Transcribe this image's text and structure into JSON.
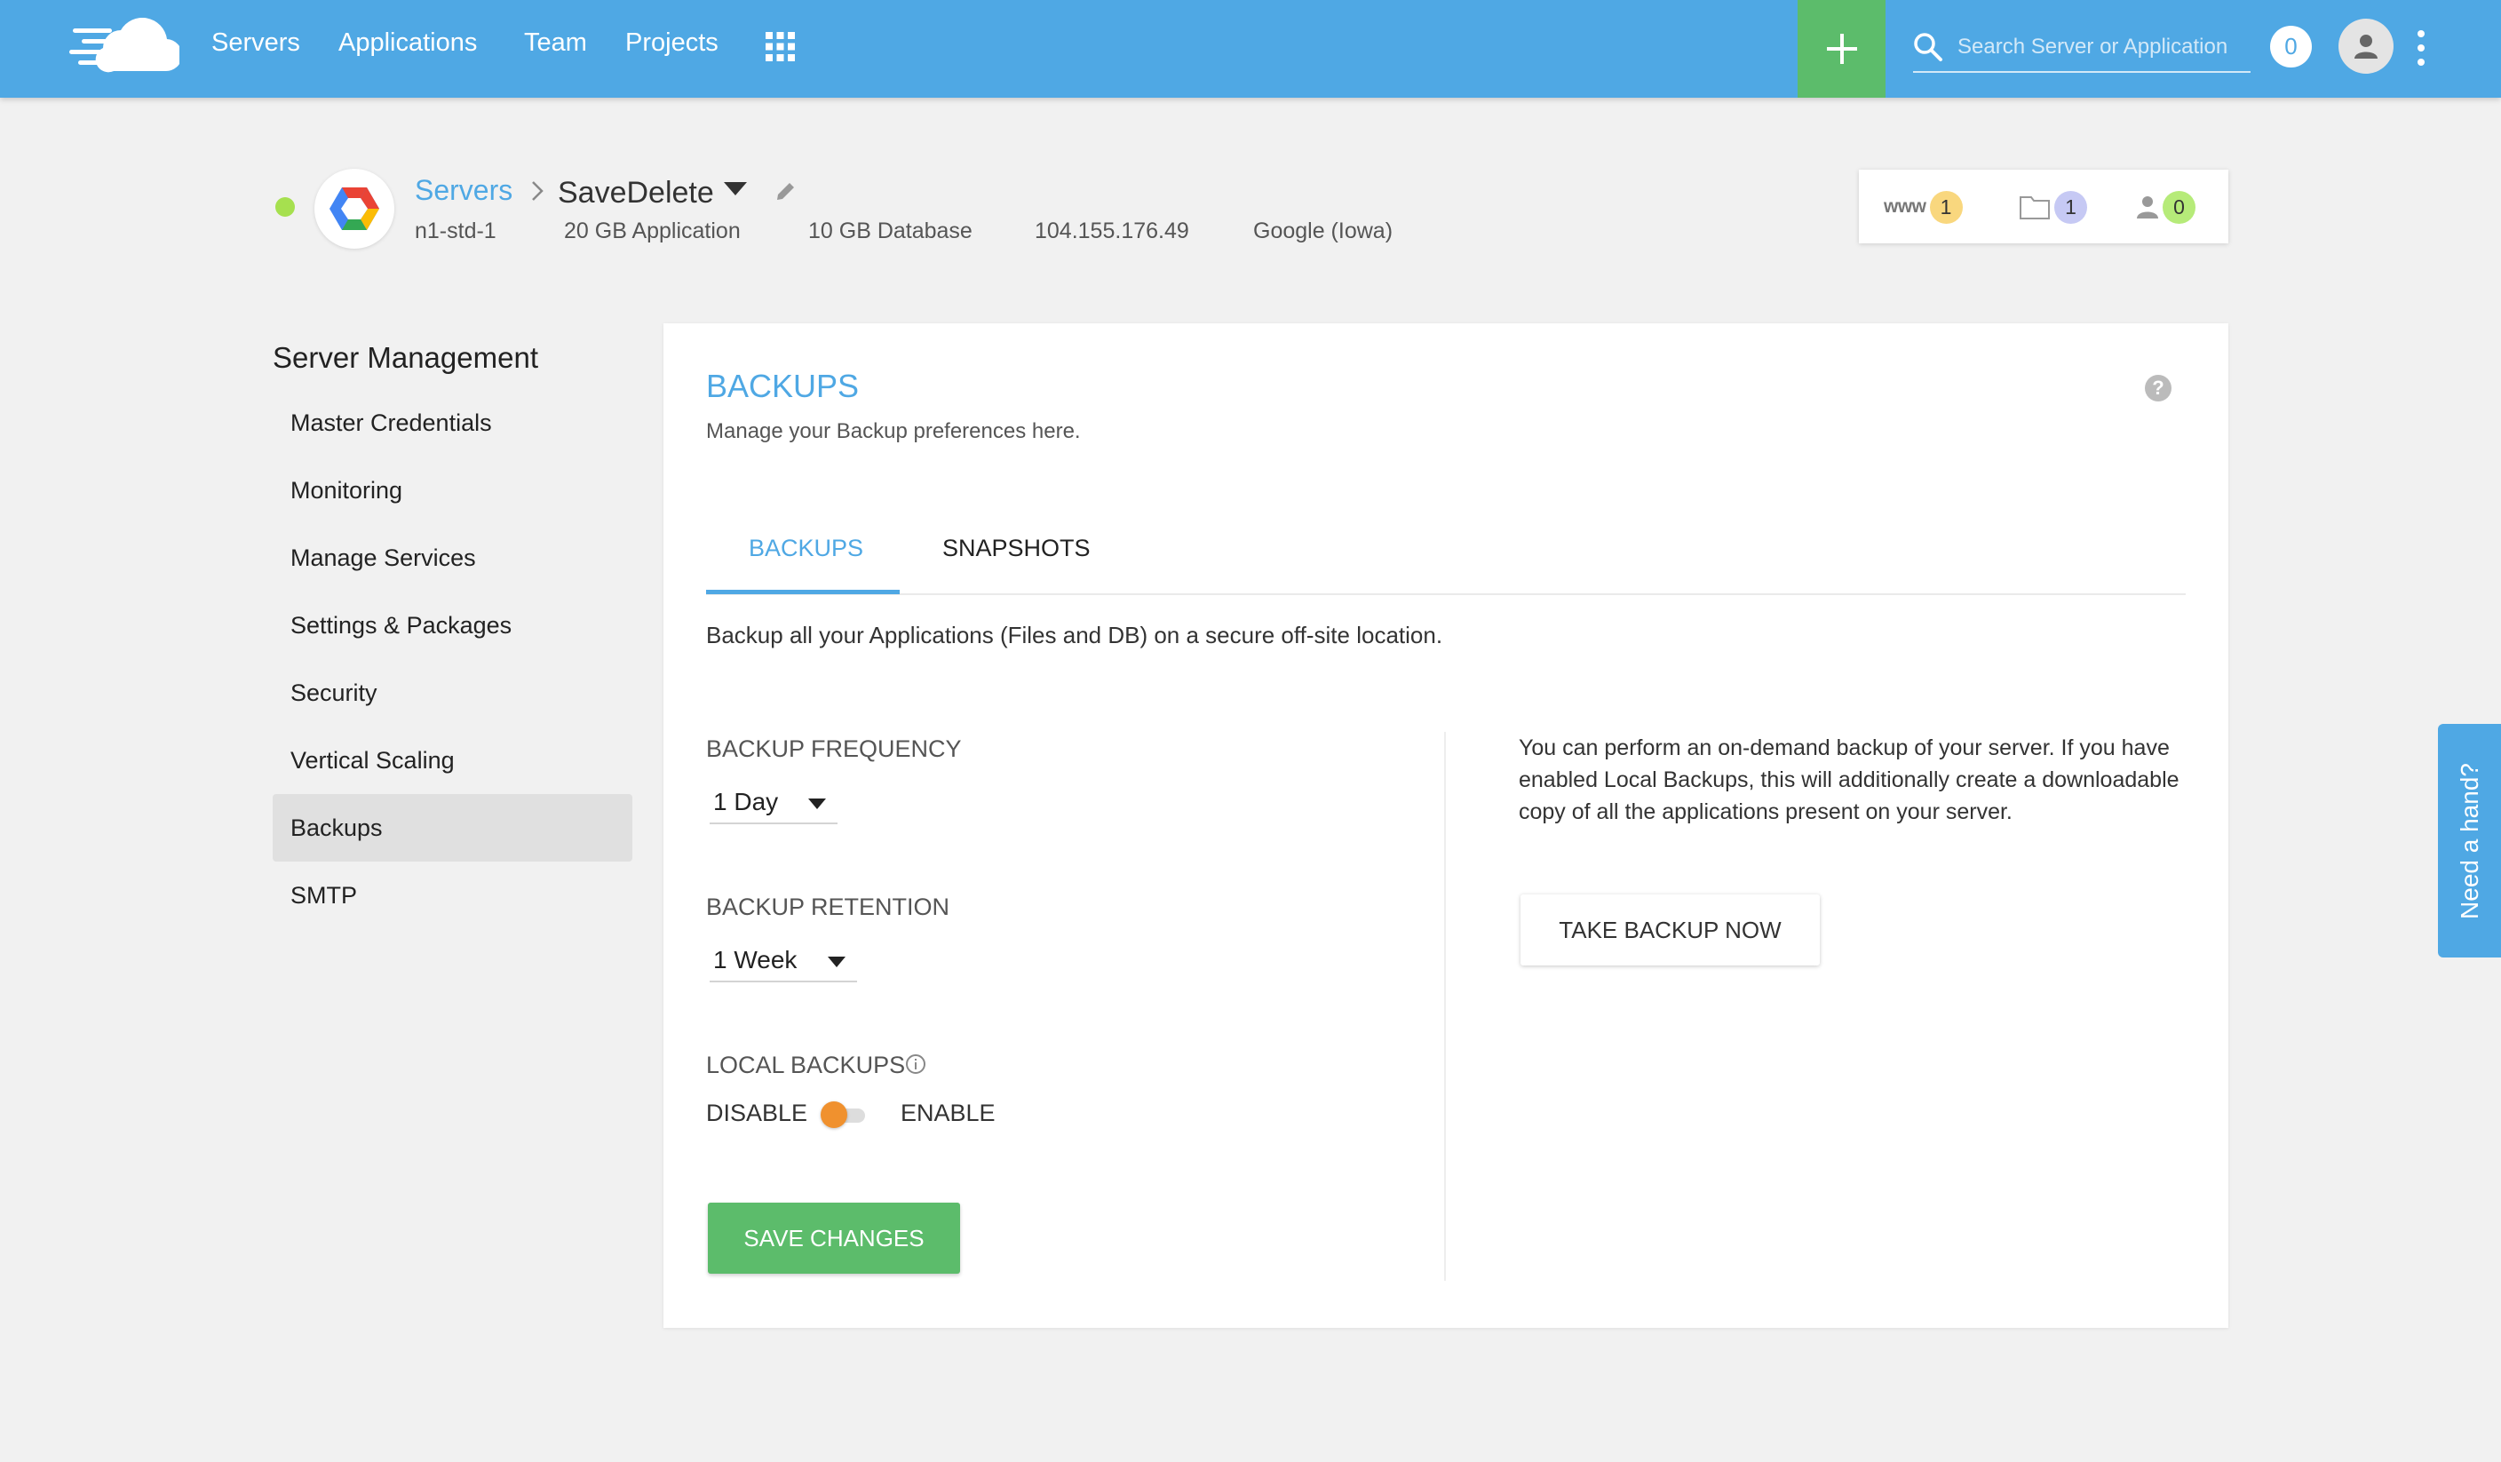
{
  "topbar": {
    "nav": [
      "Servers",
      "Applications",
      "Team",
      "Projects"
    ],
    "search_placeholder": "Search Server or Application",
    "notification_count": "0",
    "colors": {
      "bar": "#4fa8e4",
      "add": "#5cbc6b"
    }
  },
  "server": {
    "breadcrumb_root": "Servers",
    "name": "SaveDelete",
    "size": "n1-std-1",
    "app_storage": "20 GB Application",
    "db_storage": "10 GB Database",
    "ip": "104.155.176.49",
    "location": "Google (Iowa)",
    "status_color": "#a6e04f"
  },
  "counts": {
    "www_label": "www",
    "www": "1",
    "folders": "1",
    "users": "0"
  },
  "sidebar": {
    "title": "Server Management",
    "items": [
      {
        "label": "Master Credentials"
      },
      {
        "label": "Monitoring"
      },
      {
        "label": "Manage Services"
      },
      {
        "label": "Settings & Packages"
      },
      {
        "label": "Security"
      },
      {
        "label": "Vertical Scaling"
      },
      {
        "label": "Backups"
      },
      {
        "label": "SMTP"
      }
    ],
    "active": "Backups"
  },
  "main": {
    "title": "BACKUPS",
    "subtitle": "Manage your Backup preferences here.",
    "tabs": [
      {
        "label": "BACKUPS"
      },
      {
        "label": "SNAPSHOTS"
      }
    ],
    "active_tab": "BACKUPS",
    "description": "Backup all your Applications (Files and DB) on a secure off-site location.",
    "frequency_label": "BACKUP FREQUENCY",
    "frequency_value": "1 Day",
    "retention_label": "BACKUP RETENTION",
    "retention_value": "1 Week",
    "local_backups_label": "LOCAL BACKUPS",
    "toggle_off_label": "DISABLE",
    "toggle_on_label": "ENABLE",
    "local_backups_enabled": false,
    "save_label": "SAVE CHANGES",
    "ondemand_text": "You can perform an on-demand backup of your server. If you have enabled Local Backups, this will additionally create a downloadable copy of all the applications present on your server.",
    "backup_now_label": "TAKE BACKUP NOW"
  },
  "help_tab": {
    "label": "Need a hand?"
  }
}
